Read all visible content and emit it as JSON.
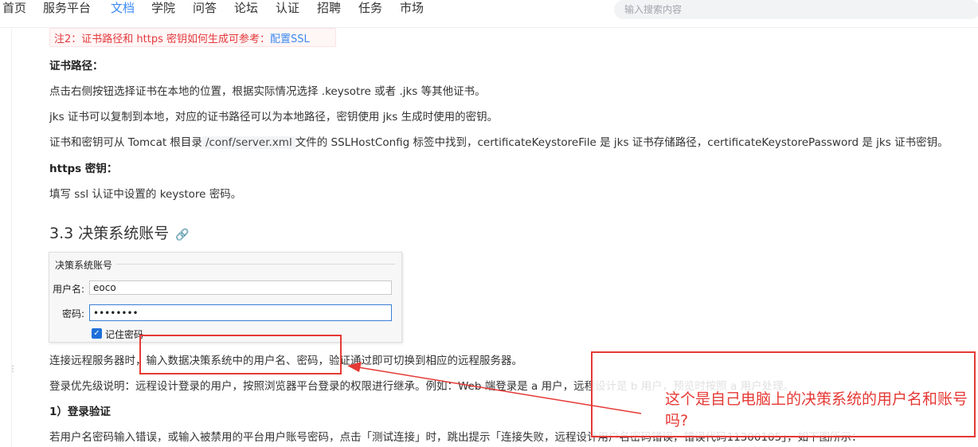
{
  "nav": {
    "items": [
      "首页",
      "服务平台",
      "文档",
      "学院",
      "问答",
      "论坛",
      "认证",
      "招聘",
      "任务",
      "市场"
    ],
    "active": "文档",
    "search_placeholder": "输入搜索内容"
  },
  "doc": {
    "note_prefix": "注2：证书路径和 https 密钥如何生成可参考：",
    "note_link": "配置SSL",
    "cert_path_heading": "证书路径：",
    "p1": "点击右侧按钮选择证书在本地的位置，根据实际情况选择 .keysotre 或者 .jks 等其他证书。",
    "p2": "jks 证书可以复制到本地，对应的证书路径可以为本地路径，密钥使用 jks 生成时使用的密钥。",
    "p3_before": "证书和密钥可从 Tomcat 根目录",
    "p3_code": "/conf/server.xml",
    "p3_after": "文件的 SSLHostConfig 标签中找到，certificateKeystoreFile 是 jks 证书存储路径，certificateKeystorePassword 是 jks 证书密钥。",
    "https_heading": "https 密钥：",
    "p4": "填写 ssl 认证中设置的 keystore 密码。",
    "section_title": "3.3 决策系统账号",
    "link_icon": "🔗",
    "p5": "连接远程服务器时，输入数据决策系统中的用户名、密码，验证通过即可切换到相应的远程服务器。",
    "p6": "登录优先级说明：远程设计登录的用户，按照浏览器平台登录的权限进行继承。例如：Web 端登录是 a 用户，远程设计是 b 用户，预览时按照 a 用户处理。",
    "login_heading": "1）登录验证",
    "p7": "若用户名密码输入错误，或输入被禁用的平台用户账号密码，点击「测试连接」时，跳出提示「连接失败，远程设计用户名密码错误，错误代码11300105」，如下图所示："
  },
  "screenshot": {
    "group_title": "决策系统账号",
    "username_label": "用户名:",
    "username_value": "eoco",
    "password_label": "密码:",
    "password_value": "••••••••",
    "remember_label": "记住密码"
  },
  "annotation": {
    "text": "这个是自己电脑上的决策系统的用户名和账号吗?",
    "color": "#e53935"
  }
}
